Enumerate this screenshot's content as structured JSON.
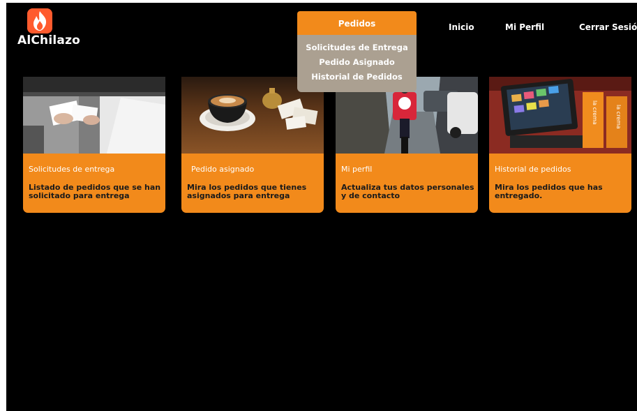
{
  "app": {
    "logo_text": "AlChilazo",
    "logo_icon": "flame-icon"
  },
  "nav": {
    "pedidos": "Pedidos",
    "inicio": "Inicio",
    "mi_perfil": "Mi Perfil",
    "cerrar_sesion": "Cerrar Sesión",
    "dropdown": [
      "Solicitudes de Entrega",
      "Pedido Asignado",
      "Historial de Pedidos"
    ]
  },
  "cards": [
    {
      "title": "Solicitudes de entrega",
      "description": "Listado de pedidos que se han solicitado para entrega"
    },
    {
      "title": "Pedido asignado",
      "description": "Mira los pedidos que tienes asignados para entrega"
    },
    {
      "title": "Mi perfil",
      "description": "Actualiza tus datos personales y de contacto"
    },
    {
      "title": "Historial de pedidos",
      "description": "Mira los pedidos que has entregado."
    }
  ],
  "colors": {
    "background": "#000000",
    "accent": "#f28a1b",
    "dropdown": "#aba091",
    "logo": "#ff5b2e"
  },
  "card4_image_text": "la crema"
}
